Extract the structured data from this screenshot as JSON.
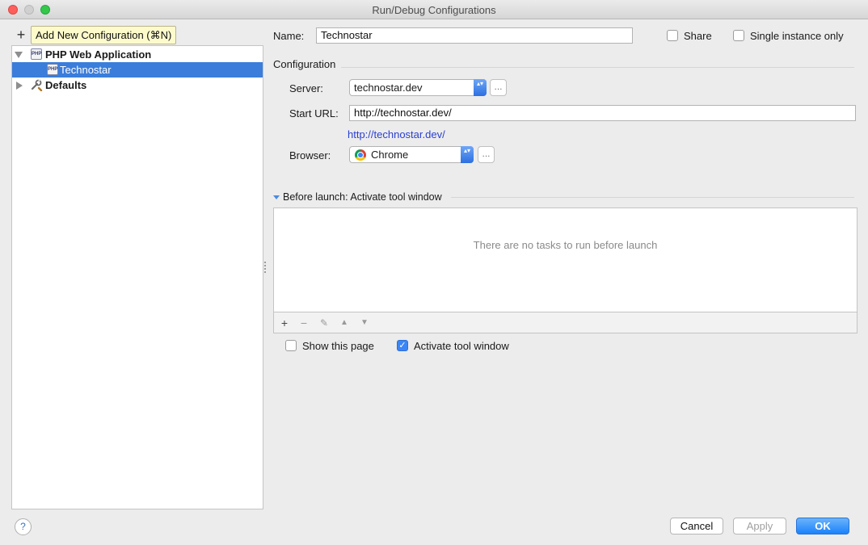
{
  "window": {
    "title": "Run/Debug Configurations"
  },
  "toolbar": {
    "add_symbol": "+",
    "tooltip": "Add New Configuration (⌘N)"
  },
  "tree": {
    "group_label": "PHP Web Application",
    "selected_item": "Technostar",
    "defaults_label": "Defaults",
    "php_icon_text": "PHP"
  },
  "form": {
    "name_label": "Name:",
    "name_value": "Technostar",
    "share_label": "Share",
    "single_instance_label": "Single instance only",
    "configuration_heading": "Configuration",
    "server_label": "Server:",
    "server_value": "technostar.dev",
    "start_url_label": "Start URL:",
    "start_url_value": "http://technostar.dev/",
    "start_url_link": "http://technostar.dev/",
    "browser_label": "Browser:",
    "browser_value": "Chrome",
    "dots": "...",
    "stepper_glyph": "▴▾"
  },
  "before_launch": {
    "heading": "Before launch: Activate tool window",
    "empty_text": "There are no tasks to run before launch",
    "toolbar": {
      "add": "+",
      "remove": "−",
      "edit": "✎",
      "up": "▲",
      "down": "▼"
    }
  },
  "options": {
    "show_page_label": "Show this page",
    "show_page_checked": false,
    "activate_label": "Activate tool window",
    "activate_checked": true,
    "check_glyph": "✓"
  },
  "buttons": {
    "cancel": "Cancel",
    "apply": "Apply",
    "ok": "OK",
    "help": "?"
  },
  "colors": {
    "selection": "#3a7ddb",
    "link": "#2a3fd1",
    "primary": "#1a82fb",
    "tooltip_bg": "#fdfbcc"
  },
  "icons": [
    "close-icon",
    "minimize-icon",
    "maximize-icon",
    "plus-icon",
    "expand-arrow-icon",
    "php-icon",
    "wrench-icon",
    "chrome-icon",
    "help-icon"
  ]
}
